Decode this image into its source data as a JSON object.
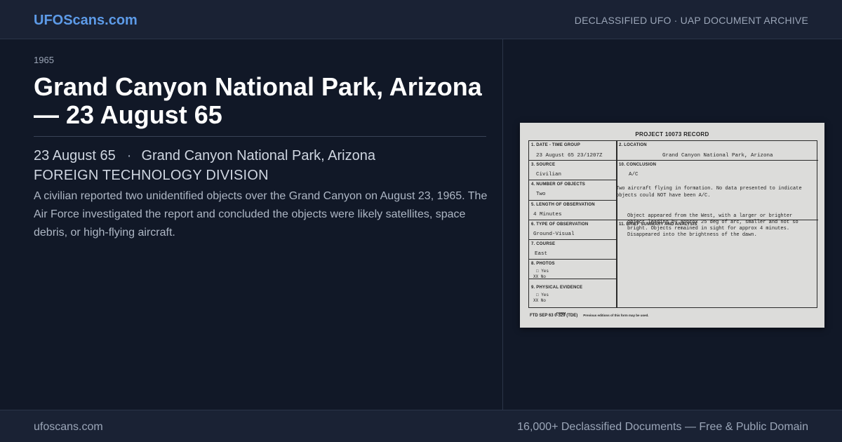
{
  "header": {
    "brand": "UFOScans.com",
    "tagline": "DECLASSIFIED UFO · UAP DOCUMENT ARCHIVE"
  },
  "case": {
    "year": "1965",
    "title": "Grand Canyon National Park, Arizona — 23 August 65",
    "date": "23 August 65",
    "separator": "·",
    "location": "Grand Canyon National Park, Arizona",
    "agency": "FOREIGN TECHNOLOGY DIVISION",
    "summary": "A civilian reported two unidentified objects over the Grand Canyon on August 23, 1965. The Air Force investigated the report and concluded the objects were likely satellites, space debris, or high-flying aircraft."
  },
  "document": {
    "heading": "PROJECT 10073 RECORD",
    "f1_label": "1.  DATE - TIME GROUP",
    "f1_value": "23 August 65   23/1207Z",
    "f2_label": "2.  LOCATION",
    "f2_value": "Grand Canyon National Park, Arizona",
    "f3_label": "3.  SOURCE",
    "f3_value": "Civilian",
    "f4_label": "4.  NUMBER OF OBJECTS",
    "f4_value": "Two",
    "f5_label": "5.  LENGTH OF OBSERVATION",
    "f5_value": "4 Minutes",
    "f6_label": "6.  TYPE OF OBSERVATION",
    "f6_value": "Ground-Visual",
    "f7_label": "7.  COURSE",
    "f7_value": "East",
    "f8_label": "8.  PHOTOS",
    "f8_yes": "□ Yes",
    "f8_no": "XX No",
    "f9_label": "9.  PHYSICAL EVIDENCE",
    "f9_yes": "□ Yes",
    "f9_no": "XX No",
    "f10_label": "10.  CONCLUSION",
    "f10_value": "A/C",
    "f10_note_1": "Two aircraft flying in formation.  No data presented to indicate",
    "f10_note_2": "objects could NOT have been A/C.",
    "f11_label": "11.  BRIEF SUMMARY AND ANALYSIS",
    "f11_line_1": "Object appeared from the West, with a larger or brighter",
    "f11_line_2": "object leading by approx 25 deg of arc, smaller and not so",
    "f11_line_3": "bright.  Objects remained in sight for approx 4 minutes.",
    "f11_line_4": "Disappeared into the brightness of the dawn.",
    "form_label": "FORM",
    "form_footer": "FTD  SEP 63  0-329  (TDE)",
    "form_note": "Previous editions of this form may be used."
  },
  "footer": {
    "site": "ufoscans.com",
    "stats": "16,000+ Declassified Documents  —  Free & Public Domain"
  }
}
